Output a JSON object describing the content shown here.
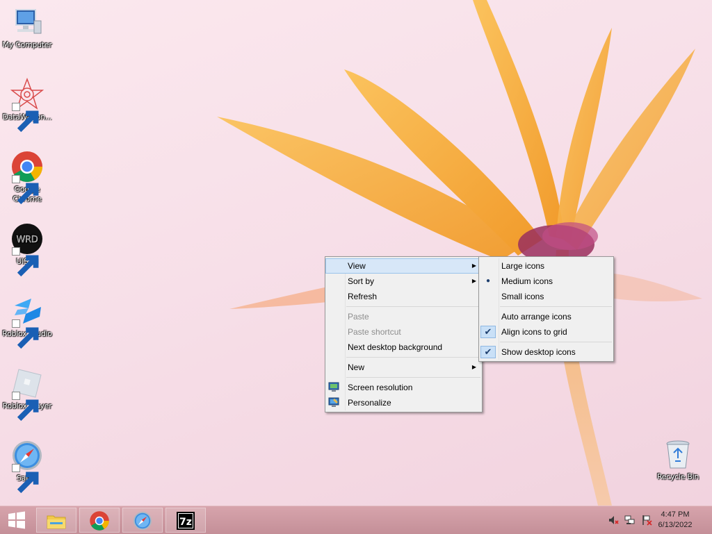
{
  "desktop": {
    "icons": [
      {
        "label": "My Computer"
      },
      {
        "label": "DataWagon..."
      },
      {
        "label": "Google Chrome"
      },
      {
        "label": "UIS UI"
      },
      {
        "label": "Roblox Studio"
      },
      {
        "label": "Roblox Player"
      },
      {
        "label": "Safari"
      },
      {
        "label": "Recycle Bin"
      }
    ],
    "wrb_logo_text": "WRD"
  },
  "context_menu": {
    "items": [
      {
        "label": "View"
      },
      {
        "label": "Sort by"
      },
      {
        "label": "Refresh"
      },
      {
        "label": "Paste"
      },
      {
        "label": "Paste shortcut"
      },
      {
        "label": "Next desktop background"
      },
      {
        "label": "New"
      },
      {
        "label": "Screen resolution"
      },
      {
        "label": "Personalize"
      }
    ]
  },
  "view_submenu": {
    "items": [
      {
        "label": "Large icons",
        "checked": false
      },
      {
        "label": "Medium icons",
        "selected": true
      },
      {
        "label": "Small icons",
        "checked": false
      },
      {
        "label": "Auto arrange icons",
        "checked": false
      },
      {
        "label": "Align icons to grid",
        "checked": true
      },
      {
        "label": "Show desktop icons",
        "checked": true
      }
    ]
  },
  "taskbar": {
    "pinned": [
      "file-explorer",
      "google-chrome",
      "safari",
      "7-zip"
    ],
    "seven_zip_label": "7z",
    "clock": {
      "time": "4:47 PM",
      "date": "6/13/2022"
    }
  },
  "colors": {
    "taskbar": "#c48f98",
    "menu_highlight": "#d7e7f8",
    "wallpaper_petal": "#f5a623"
  }
}
